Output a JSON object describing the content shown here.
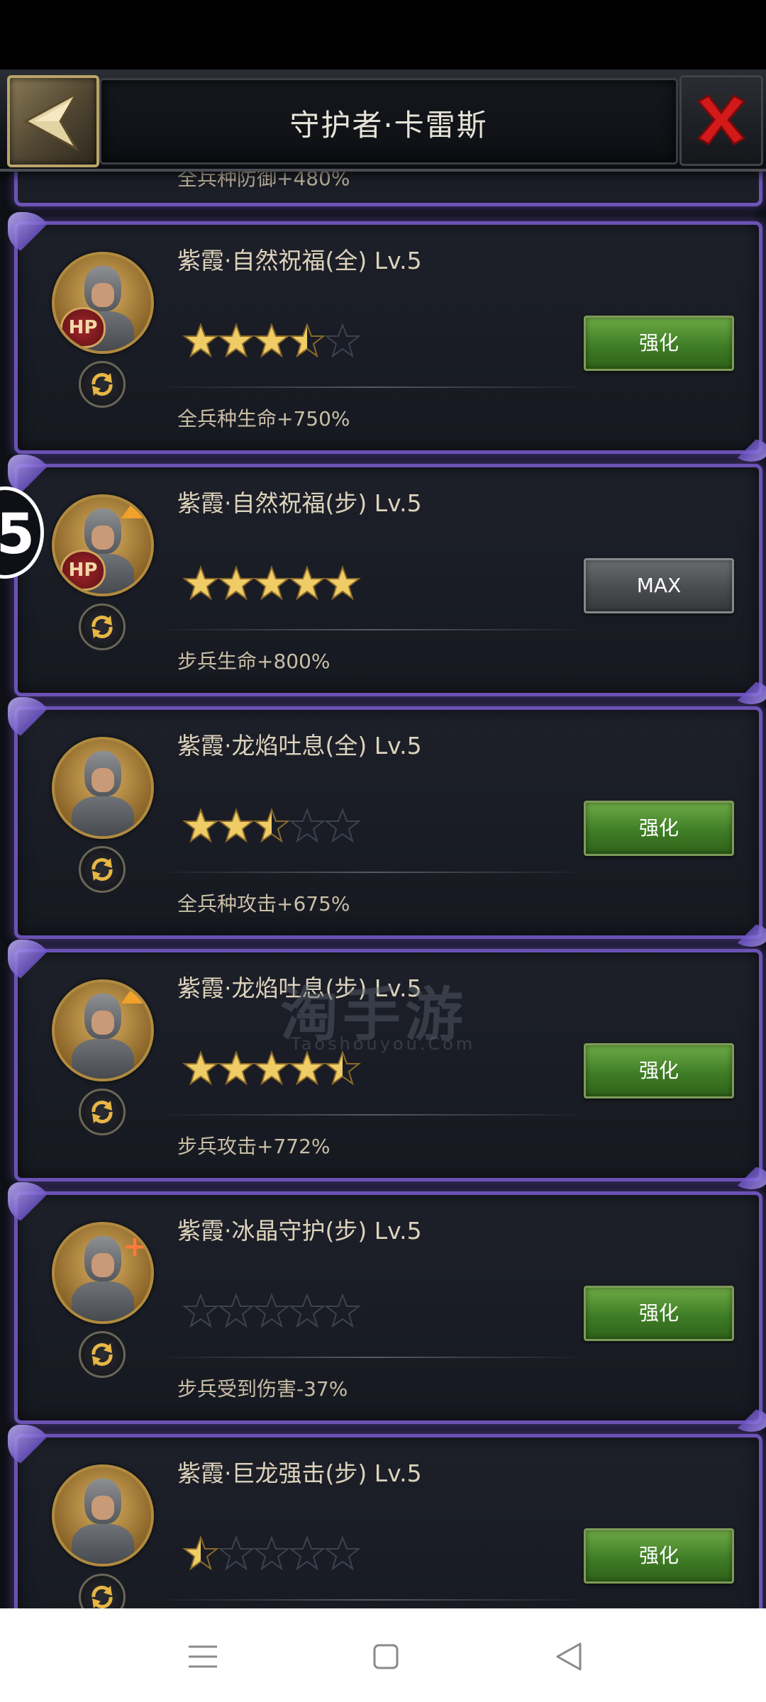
{
  "header": {
    "title": "守护者·卡雷斯",
    "back_icon": "back-arrow-icon",
    "close_icon": "close-x-icon"
  },
  "side_marker": {
    "text": "5"
  },
  "partial_card": {
    "effect": "全兵种防御+480%"
  },
  "cards": [
    {
      "name": "紫霞·自然祝福(全) Lv.5",
      "effect": "全兵种生命+750%",
      "stars": 3.5,
      "button": "强化",
      "badge": "HP",
      "portrait": "helmet-knight"
    },
    {
      "name": "紫霞·自然祝福(步) Lv.5",
      "effect": "步兵生命+800%",
      "stars": 5,
      "button": "MAX",
      "badge": "HP",
      "portrait": "infantry-up"
    },
    {
      "name": "紫霞·龙焰吐息(全) Lv.5",
      "effect": "全兵种攻击+675%",
      "stars": 2.5,
      "button": "强化",
      "badge": "",
      "portrait": "helmet-knight-sword"
    },
    {
      "name": "紫霞·龙焰吐息(步) Lv.5",
      "effect": "步兵攻击+772%",
      "stars": 4.5,
      "button": "强化",
      "badge": "",
      "portrait": "infantry-up-sword"
    },
    {
      "name": "紫霞·冰晶守护(步) Lv.5",
      "effect": "步兵受到伤害-37%",
      "stars": 0,
      "button": "强化",
      "badge": "",
      "portrait": "infantry-shield-plus"
    },
    {
      "name": "紫霞·巨龙强击(步) Lv.5",
      "effect": "",
      "stars": 0.5,
      "button": "强化",
      "badge": "",
      "portrait": "infantry-sword"
    }
  ],
  "watermark": {
    "main": "淘手游",
    "sub": "Taoshouyou.Com"
  },
  "nav": {
    "menu_icon": "menu-icon",
    "home_icon": "home-square-icon",
    "back_icon": "back-triangle-icon"
  },
  "colors": {
    "accent_purple": "#6b52b5",
    "button_green": "#4f8f2f",
    "button_gray": "#55575b",
    "star_gold": "#e6c15c"
  }
}
